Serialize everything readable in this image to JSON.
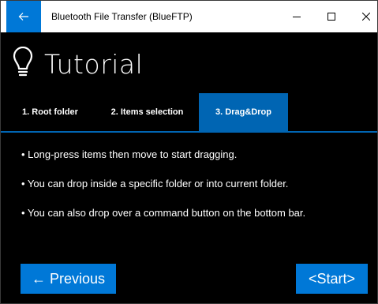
{
  "window": {
    "title": "Bluetooth File Transfer (BlueFTP)",
    "accent_color": "#0078d7"
  },
  "titlebar": {
    "back_icon": "back-arrow-icon",
    "minimize_icon": "minimize-icon",
    "maximize_icon": "maximize-icon",
    "close_icon": "close-icon"
  },
  "header": {
    "icon": "lightbulb-icon",
    "title": "Tutorial"
  },
  "tabs": [
    {
      "label": "1. Root folder",
      "selected": false
    },
    {
      "label": "2. Items selection",
      "selected": false
    },
    {
      "label": "3. Drag&Drop",
      "selected": true
    }
  ],
  "content": {
    "items": [
      "• Long-press items then move to start dragging.",
      "• You can drop inside a specific folder or into current folder.",
      "• You can also drop over a command button on the bottom bar."
    ]
  },
  "buttons": {
    "previous_label": "← Previous",
    "start_label": "<Start>"
  }
}
